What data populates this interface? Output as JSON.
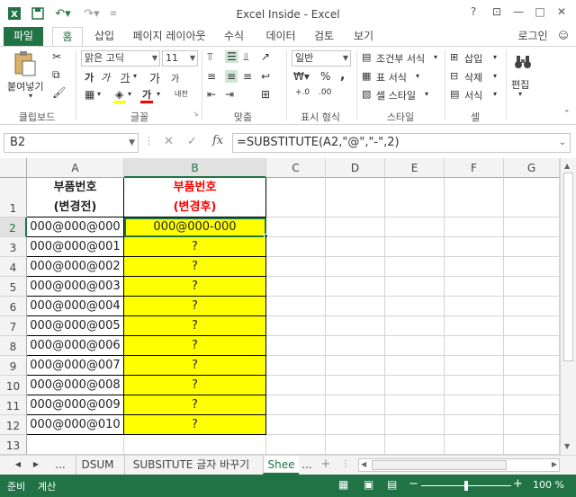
{
  "window": {
    "title": "Excel Inside - Excel",
    "help": "?",
    "minimize": "—",
    "restore": "□",
    "close": "✕"
  },
  "tabs": [
    "파일",
    "홈",
    "삽입",
    "페이지 레이아웃",
    "수식",
    "데이터",
    "검토",
    "보기"
  ],
  "signin": "로그인",
  "ribbon": {
    "paste_label": "붙여넣기",
    "font_name": "맑은 고딕",
    "font_size": "11",
    "bold": "가",
    "italic": "가",
    "underline": "가",
    "grow_font": "가",
    "shrink_font": "가",
    "font_color_glyph": "가",
    "ruby_glyph": "내천",
    "number_format": "일반",
    "percent": "%",
    "comma": ",",
    "conditional": "조건부 서식",
    "table_format": "표 서식",
    "cell_style": "셀 스타일",
    "insert": "삽입",
    "delete": "삭제",
    "format": "서식",
    "edit": "편집",
    "groups": [
      "클립보드",
      "글꼴",
      "맞춤",
      "표시 형식",
      "스타일",
      "셀"
    ]
  },
  "formula_bar": {
    "name_box": "B2",
    "formula": "=SUBSTITUTE(A2,\"@\",\"-\",2)",
    "cancel": "✕",
    "enter": "✓",
    "fx": "fx"
  },
  "grid": {
    "columns": [
      "A",
      "B",
      "C",
      "D",
      "E",
      "F",
      "G"
    ],
    "header_a": [
      "부품번호",
      "(변경전)"
    ],
    "header_b": [
      "부품번호",
      "(변경후)"
    ],
    "rows": [
      {
        "n": "1"
      },
      {
        "n": "2",
        "a": "000@000@000",
        "b": "000@000-000"
      },
      {
        "n": "3",
        "a": "000@000@001",
        "b": "?"
      },
      {
        "n": "4",
        "a": "000@000@002",
        "b": "?"
      },
      {
        "n": "5",
        "a": "000@000@003",
        "b": "?"
      },
      {
        "n": "6",
        "a": "000@000@004",
        "b": "?"
      },
      {
        "n": "7",
        "a": "000@000@005",
        "b": "?"
      },
      {
        "n": "8",
        "a": "000@000@006",
        "b": "?"
      },
      {
        "n": "9",
        "a": "000@000@007",
        "b": "?"
      },
      {
        "n": "10",
        "a": "000@000@008",
        "b": "?"
      },
      {
        "n": "11",
        "a": "000@000@009",
        "b": "?"
      },
      {
        "n": "12",
        "a": "000@000@010",
        "b": "?"
      },
      {
        "n": "13"
      }
    ]
  },
  "sheets": {
    "more": "...",
    "items": [
      "DSUM",
      "SUBSITUTE 글자 바꾸기",
      "Shee"
    ],
    "more2": "...",
    "add": "+"
  },
  "status": {
    "ready": "준비",
    "calc": "계산",
    "zoom": "100 %",
    "minus": "−",
    "plus": "+"
  },
  "colors": {
    "accent": "#217346",
    "highlight": "#ffff00",
    "red_header": "#ff0000"
  }
}
